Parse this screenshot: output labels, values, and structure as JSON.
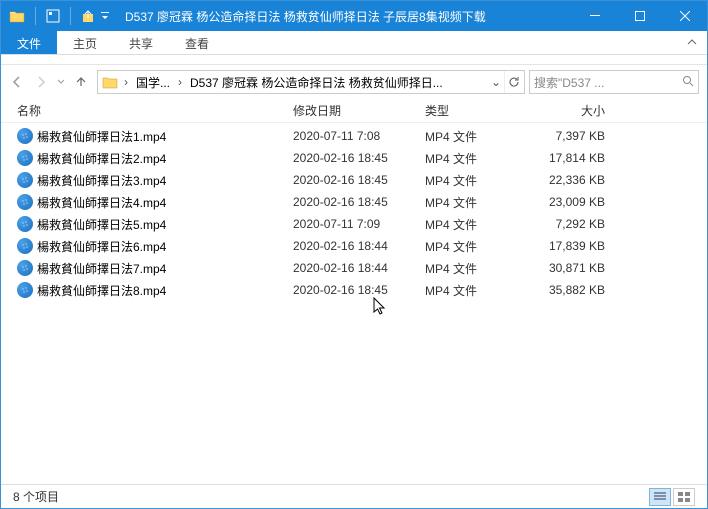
{
  "window_title": "D537 廖冠霖 杨公造命择日法 杨救贫仙师择日法 子辰居8集视频下载",
  "ribbon": {
    "file": "文件",
    "home": "主页",
    "share": "共享",
    "view": "查看"
  },
  "breadcrumb": {
    "root": "国学...",
    "leaf": "D537 廖冠霖 杨公造命择日法 杨救贫仙师择日..."
  },
  "search_placeholder": "搜索\"D537 ...",
  "columns": {
    "name": "名称",
    "modified": "修改日期",
    "type": "类型",
    "size": "大小"
  },
  "files": [
    {
      "name": "楊救貧仙師擇日法1.mp4",
      "modified": "2020-07-11 7:08",
      "type": "MP4 文件",
      "size": "7,397 KB"
    },
    {
      "name": "楊救貧仙師擇日法2.mp4",
      "modified": "2020-02-16 18:45",
      "type": "MP4 文件",
      "size": "17,814 KB"
    },
    {
      "name": "楊救貧仙師擇日法3.mp4",
      "modified": "2020-02-16 18:45",
      "type": "MP4 文件",
      "size": "22,336 KB"
    },
    {
      "name": "楊救貧仙師擇日法4.mp4",
      "modified": "2020-02-16 18:45",
      "type": "MP4 文件",
      "size": "23,009 KB"
    },
    {
      "name": "楊救貧仙師擇日法5.mp4",
      "modified": "2020-07-11 7:09",
      "type": "MP4 文件",
      "size": "7,292 KB"
    },
    {
      "name": "楊救貧仙師擇日法6.mp4",
      "modified": "2020-02-16 18:44",
      "type": "MP4 文件",
      "size": "17,839 KB"
    },
    {
      "name": "楊救貧仙師擇日法7.mp4",
      "modified": "2020-02-16 18:44",
      "type": "MP4 文件",
      "size": "30,871 KB"
    },
    {
      "name": "楊救貧仙師擇日法8.mp4",
      "modified": "2020-02-16 18:45",
      "type": "MP4 文件",
      "size": "35,882 KB"
    }
  ],
  "status": "8 个项目"
}
